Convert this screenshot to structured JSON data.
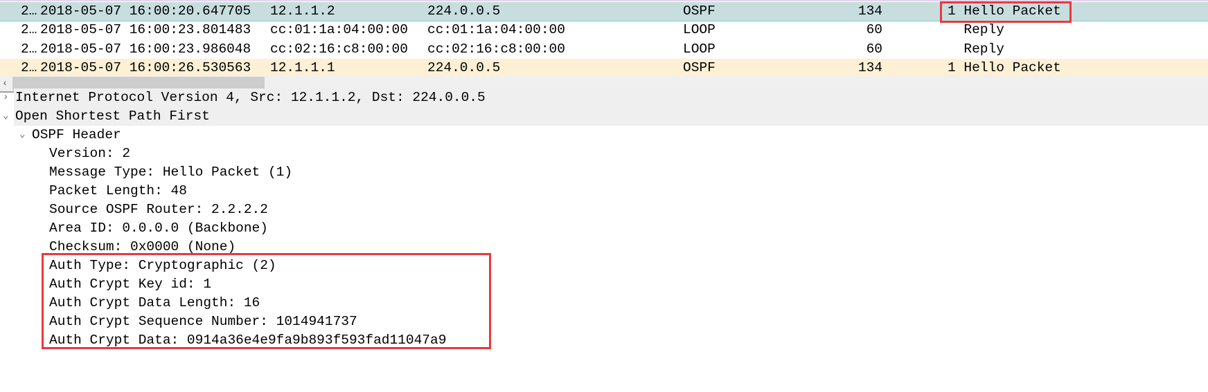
{
  "packets": [
    {
      "no": "2…",
      "time": "2018-05-07 16:00:20.647705",
      "src": "12.1.1.2",
      "dst": "224.0.0.5",
      "proto": "OSPF",
      "len": "134",
      "info": "1 Hello Packet",
      "state": "selected"
    },
    {
      "no": "2…",
      "time": "2018-05-07 16:00:23.801483",
      "src": "cc:01:1a:04:00:00",
      "dst": "cc:01:1a:04:00:00",
      "proto": "LOOP",
      "len": "60",
      "info": "  Reply",
      "state": "normal"
    },
    {
      "no": "2…",
      "time": "2018-05-07 16:00:23.986048",
      "src": "cc:02:16:c8:00:00",
      "dst": "cc:02:16:c8:00:00",
      "proto": "LOOP",
      "len": "60",
      "info": "  Reply",
      "state": "normal"
    },
    {
      "no": "2…",
      "time": "2018-05-07 16:00:26.530563",
      "src": "12.1.1.1",
      "dst": "224.0.0.5",
      "proto": "OSPF",
      "len": "134",
      "info": "1 Hello Packet",
      "state": "warn"
    }
  ],
  "scroll_left_icon": "‹",
  "details": [
    {
      "text": "Internet Protocol Version 4, Src: 12.1.1.2, Dst: 224.0.0.5",
      "level": 0,
      "toggle": "›"
    },
    {
      "text": "Open Shortest Path First",
      "level": 0,
      "toggle": "⌄"
    },
    {
      "text": "OSPF Header",
      "level": 1,
      "toggle": "⌄"
    },
    {
      "text": "Version: 2",
      "level": 2
    },
    {
      "text": "Message Type: Hello Packet (1)",
      "level": 2
    },
    {
      "text": "Packet Length: 48",
      "level": 2
    },
    {
      "text": "Source OSPF Router: 2.2.2.2",
      "level": 2
    },
    {
      "text": "Area ID: 0.0.0.0 (Backbone)",
      "level": 2
    },
    {
      "text": "Checksum: 0x0000 (None)",
      "level": 2
    },
    {
      "text": "Auth Type: Cryptographic (2)",
      "level": 2
    },
    {
      "text": "Auth Crypt Key id: 1",
      "level": 2
    },
    {
      "text": "Auth Crypt Data Length: 16",
      "level": 2
    },
    {
      "text": "Auth Crypt Sequence Number: 1014941737",
      "level": 2
    },
    {
      "text": "Auth Crypt Data: 0914a36e4e9fa9b893f593fad11047a9",
      "level": 2
    }
  ],
  "colors": {
    "selected_row": "#c8dede",
    "warn_row": "#fdf0d5",
    "highlight_box": "#e8393f"
  }
}
